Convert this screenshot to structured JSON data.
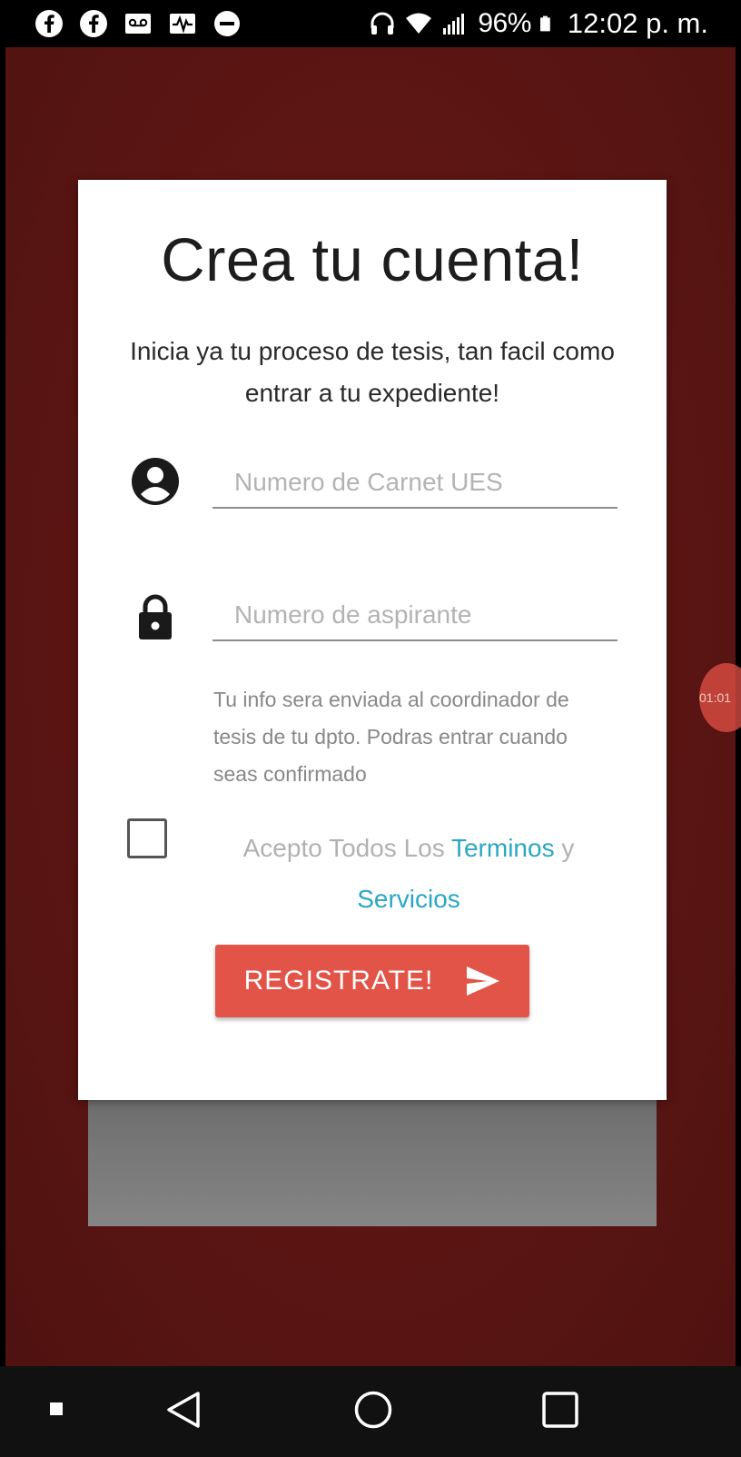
{
  "status_bar": {
    "left_icons": [
      "facebook-icon",
      "facebook-icon",
      "voicemail-icon",
      "activity-icon",
      "do-not-disturb-icon"
    ],
    "right_icons": [
      "headphones-icon",
      "wifi-icon",
      "signal-icon",
      "battery-icon"
    ],
    "battery": "96%",
    "time": "12:02 p. m."
  },
  "overlay": {
    "bubble_text": "01:01"
  },
  "card": {
    "title": "Crea tu cuenta!",
    "subtitle": "Inicia ya tu proceso de tesis, tan facil como entrar a tu expediente!",
    "carnet_field": {
      "icon": "account-circle-icon",
      "placeholder": "Numero de Carnet UES",
      "value": ""
    },
    "aspirante_field": {
      "icon": "lock-icon",
      "placeholder": "Numero de aspirante",
      "value": ""
    },
    "helper_text": "Tu info sera enviada al coordinador de tesis de tu dpto. Podras entrar cuando seas confirmado",
    "terms": {
      "checked": false,
      "prefix": "Acepto Todos Los ",
      "terms_link": "Terminos",
      "conjunction": " y ",
      "services_link": "Servicios"
    },
    "register_button": {
      "label": "REGISTRATE!",
      "icon": "send-icon"
    }
  },
  "colors": {
    "background": "#5c1614",
    "button": "#e25447",
    "link": "#2ba7c2"
  },
  "nav_bar": {
    "icons": [
      "recents-dot-icon",
      "back-icon",
      "home-icon",
      "overview-icon"
    ]
  }
}
